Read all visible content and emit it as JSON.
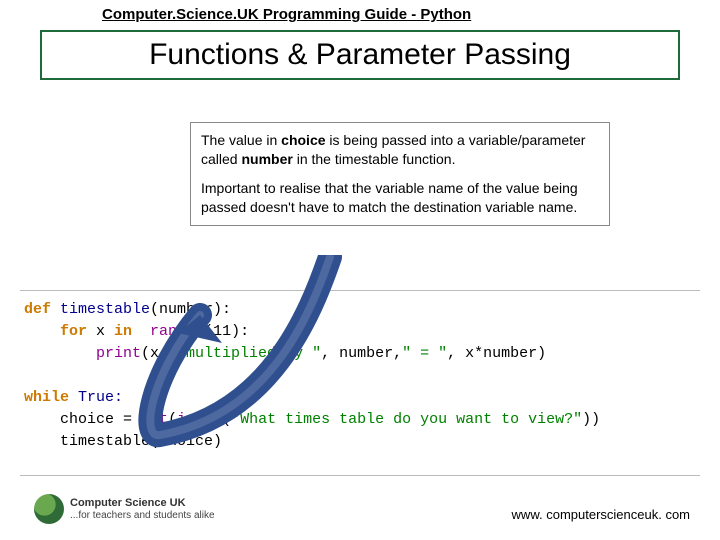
{
  "header": {
    "title": "Computer.Science.UK Programming Guide - Python"
  },
  "main": {
    "heading": "Functions & Parameter Passing"
  },
  "callout": {
    "p1_a": "The value in ",
    "p1_b": "choice",
    "p1_c": " is being passed into a variable/parameter called ",
    "p1_d": "number",
    "p1_e": " in the timestable function.",
    "p2": "Important to realise that the variable name of the value being passed doesn't have to match the destination variable name."
  },
  "code": {
    "l1_a": "def ",
    "l1_b": "timestable",
    "l1_c": "(number):",
    "l2_a": "    for ",
    "l2_b": "x ",
    "l2_c": "in ",
    "l2_d": " range ",
    "l2_e": "(",
    "l2_f": "11",
    "l2_g": "):",
    "l3_a": "        print",
    "l3_b": "(x, ",
    "l3_c": "\"multiplied by \"",
    "l3_d": ", number,",
    "l3_e": "\" = \"",
    "l3_f": ", x*number)",
    "l5_a": "while ",
    "l5_b": "True:",
    "l6_a": "    choice ",
    "l6_b": "= ",
    "l6_c": "int",
    "l6_d": "(",
    "l6_e": "input",
    "l6_f": "(",
    "l6_g": "\"What times table do you want to view?\"",
    "l6_h": "))",
    "l7_a": "    timestable(choice)"
  },
  "footer": {
    "brand1": "Computer Science UK",
    "brand2": "...for teachers and students alike",
    "url": "www. computerscienceuk. com"
  }
}
